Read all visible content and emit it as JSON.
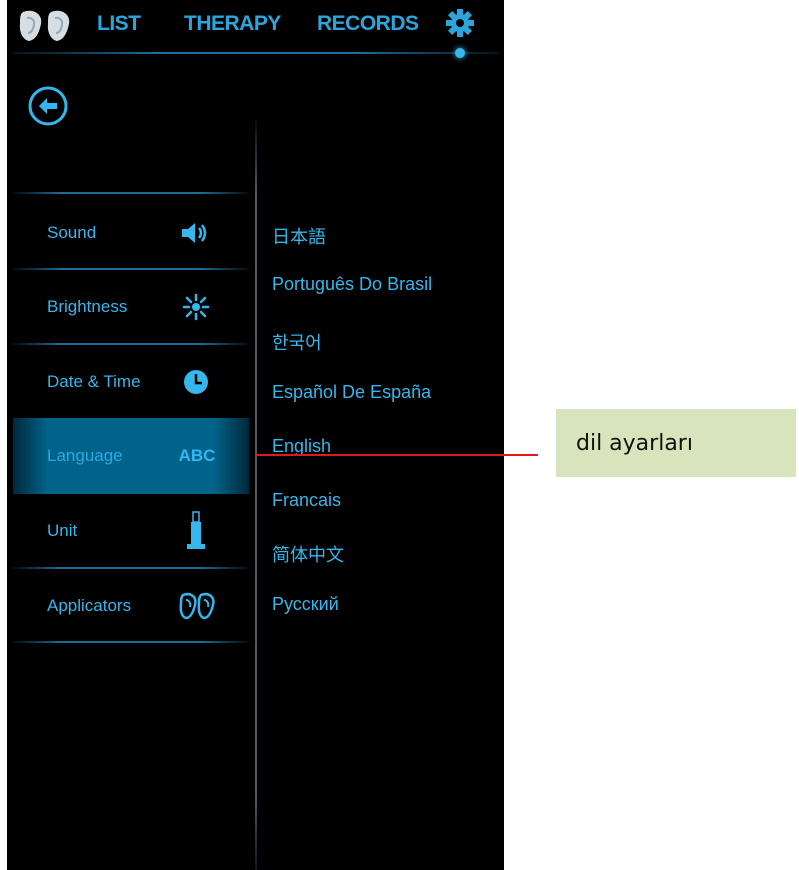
{
  "nav": {
    "logo_icon": "applicators-logo-icon",
    "tabs": [
      {
        "label": "LIST"
      },
      {
        "label": "THERAPY"
      },
      {
        "label": "RECORDS"
      }
    ],
    "settings_icon": "gear-icon"
  },
  "back_icon": "back-arrow-icon",
  "menu": {
    "items": [
      {
        "label": "Sound",
        "icon": "speaker-icon"
      },
      {
        "label": "Brightness",
        "icon": "brightness-icon"
      },
      {
        "label": "Date & Time",
        "icon": "clock-icon"
      },
      {
        "label": "Language",
        "icon": "abc-icon",
        "icon_text": "ABC",
        "active": true
      },
      {
        "label": "Unit",
        "icon": "unit-icon"
      },
      {
        "label": "Applicators",
        "icon": "applicators-icon"
      }
    ]
  },
  "languages": [
    "日本語",
    "Português Do Brasil",
    "한국어",
    "Español De España",
    "English",
    "Francais",
    "简体中文",
    "Русский"
  ],
  "annotation": {
    "text": "dil ayarları"
  },
  "colors": {
    "accent": "#35b6ec",
    "active_bg": "#00638a",
    "background": "#000000",
    "annotation_box": "#d8e4bc",
    "annotation_line": "#e01a1a"
  }
}
